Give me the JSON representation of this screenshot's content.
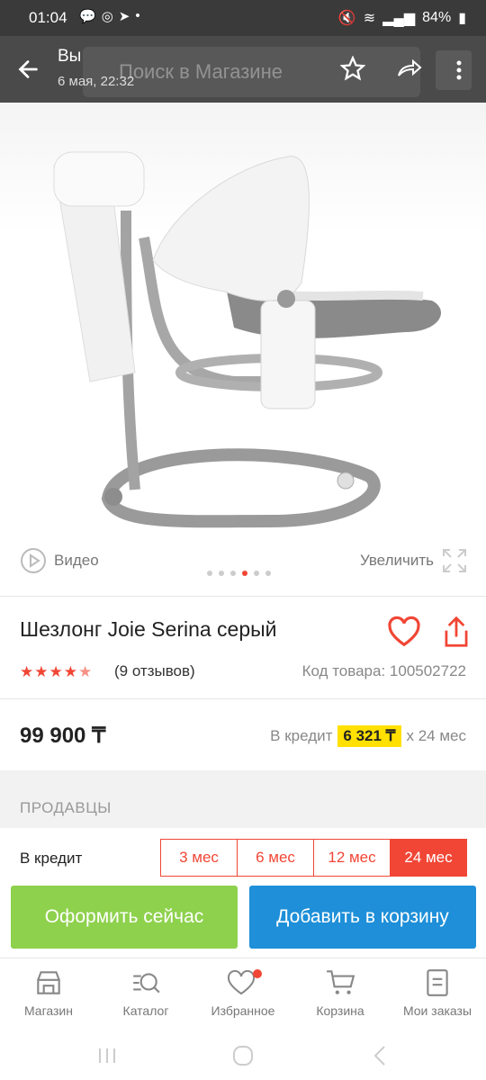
{
  "status_bar": {
    "time": "01:04",
    "battery": "84%"
  },
  "header": {
    "title": "Вы",
    "subtitle": "6 мая, 22:32",
    "search_placeholder": "Поиск в Магазине"
  },
  "media": {
    "video_label": "Видео",
    "zoom_label": "Увеличить",
    "dots_count": 6,
    "active_dot": 4
  },
  "product": {
    "title": "Шезлонг Joie Serina серый",
    "rating_stars": 4.5,
    "reviews": "(9 отзывов)",
    "code": "Код товара: 100502722",
    "price": "99 900 ₸",
    "credit_prefix": "В кредит",
    "credit_amount": "6 321 ₸",
    "credit_suffix": "x 24 мес"
  },
  "sellers": {
    "heading": "ПРОДАВЦЫ"
  },
  "credit_terms": {
    "label": "В кредит",
    "options": [
      "3 мес",
      "6 мес",
      "12 мес",
      "24 мес"
    ],
    "selected": "24 мес"
  },
  "actions": {
    "buy_now": "Оформить сейчас",
    "add_to_cart": "Добавить в корзину"
  },
  "tabs": [
    {
      "label": "Магазин",
      "icon": "store-icon"
    },
    {
      "label": "Каталог",
      "icon": "catalog-search-icon"
    },
    {
      "label": "Избранное",
      "icon": "heart-icon"
    },
    {
      "label": "Корзина",
      "icon": "cart-icon"
    },
    {
      "label": "Мои заказы",
      "icon": "orders-icon"
    }
  ],
  "colors": {
    "accent": "#f14635",
    "buy": "#8ed14d",
    "cart": "#1e8fd8",
    "credit_highlight": "#ffe000"
  }
}
